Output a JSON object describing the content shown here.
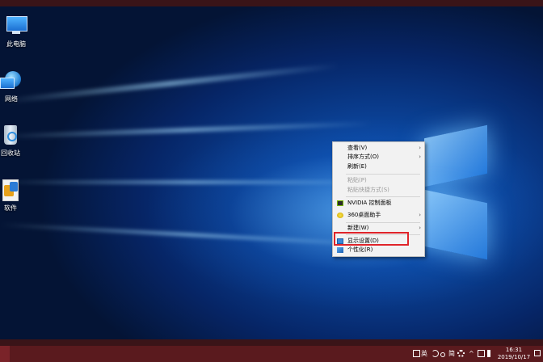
{
  "desktop": {
    "icons": [
      {
        "label": "此电脑",
        "icon": "computer-icon"
      },
      {
        "label": "网络",
        "icon": "network-icon"
      },
      {
        "label": "回收站",
        "icon": "recycle-bin-icon"
      },
      {
        "label": "软件",
        "icon": "software-folder-icon"
      }
    ]
  },
  "context_menu": {
    "items": [
      {
        "label": "查看(V)",
        "submenu": true,
        "enabled": true
      },
      {
        "label": "排序方式(O)",
        "submenu": true,
        "enabled": true
      },
      {
        "label": "刷新(E)",
        "submenu": false,
        "enabled": true
      },
      {
        "label": "粘贴(P)",
        "submenu": false,
        "enabled": false
      },
      {
        "label": "粘贴快捷方式(S)",
        "submenu": false,
        "enabled": false
      },
      {
        "label": "NVIDIA 控制面板",
        "submenu": false,
        "enabled": true,
        "icon": "nvidia-icon"
      },
      {
        "label": "360桌面助手",
        "submenu": true,
        "enabled": true,
        "icon": "360-icon"
      },
      {
        "label": "新建(W)",
        "submenu": true,
        "enabled": true
      },
      {
        "label": "显示设置(D)",
        "submenu": false,
        "enabled": true,
        "icon": "display-settings-icon",
        "highlighted": true
      },
      {
        "label": "个性化(R)",
        "submenu": false,
        "enabled": true,
        "icon": "personalize-icon"
      }
    ],
    "arrow_glyph": "›"
  },
  "taskbar": {
    "tray": {
      "ime_lang": "英",
      "ime_mode": "简",
      "chevron": "^"
    },
    "clock": {
      "time": "16:31",
      "date": "2019/10/17"
    }
  },
  "colors": {
    "highlight_border": "#e0242a",
    "taskbar": "#5a1a1e"
  }
}
